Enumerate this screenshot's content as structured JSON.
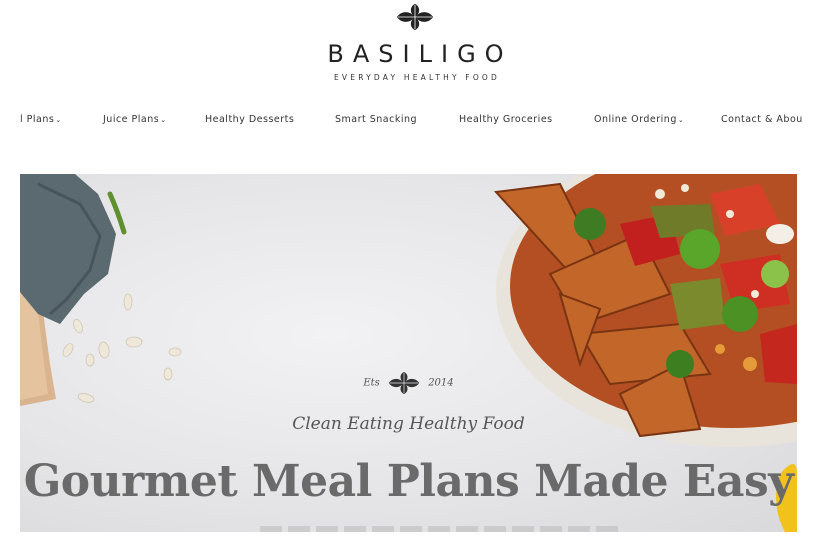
{
  "brand": {
    "name": "BASILIGO",
    "tagline": "EVERYDAY HEALTHY FOOD",
    "logo_icon": "basil-leaves-icon"
  },
  "nav": {
    "items": [
      {
        "label": "l Plans",
        "dropdown": true
      },
      {
        "label": "Juice Plans",
        "dropdown": true
      },
      {
        "label": "Healthy Desserts",
        "dropdown": false
      },
      {
        "label": "Smart Snacking",
        "dropdown": false
      },
      {
        "label": "Healthy Groceries",
        "dropdown": false
      },
      {
        "label": "Online Ordering",
        "dropdown": true
      },
      {
        "label": "Contact & Abou",
        "dropdown": false
      }
    ],
    "caret": "⌄"
  },
  "hero": {
    "est_left": "Ets",
    "est_right": "2014",
    "script_line": "Clean Eating Healthy Food",
    "headline": "Gourmet Meal Plans Made Easy"
  },
  "colors": {
    "background": "#ffffff",
    "text": "#333333",
    "headline": "#6a6a6a",
    "hero_bg": "#e8e8ea"
  }
}
